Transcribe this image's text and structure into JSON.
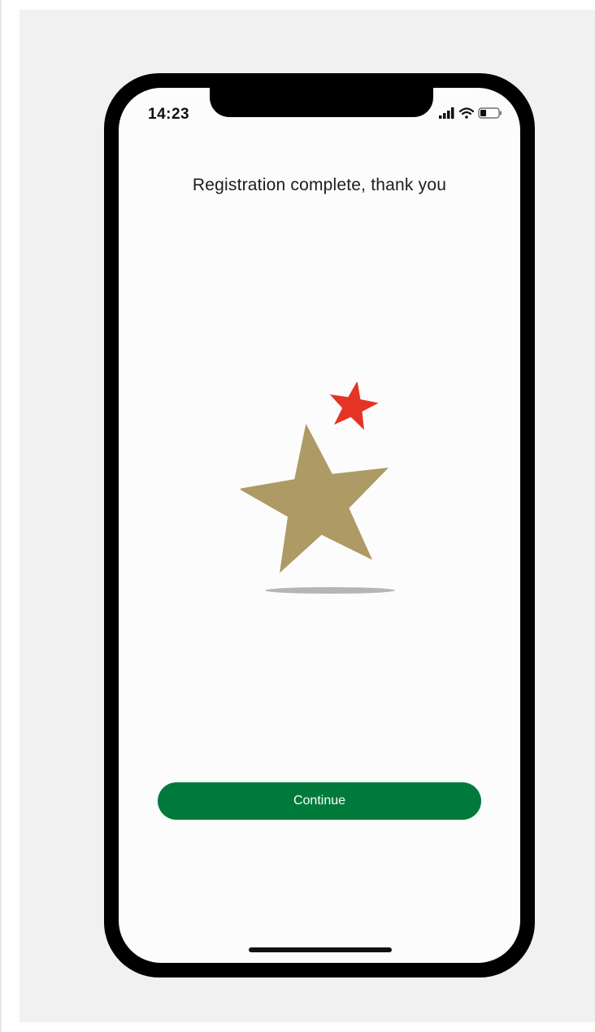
{
  "status_bar": {
    "time": "14:23",
    "icons": [
      "signal-icon",
      "wifi-icon",
      "battery-icon"
    ]
  },
  "page": {
    "title": "Registration complete, thank you"
  },
  "illustration": {
    "icon": "star-logo-icon",
    "colors": {
      "large_star": "#ad9a64",
      "small_star": "#e53325",
      "shadow": "#b5b5b5"
    }
  },
  "actions": {
    "continue_label": "Continue",
    "continue_color": "#007a3b"
  }
}
